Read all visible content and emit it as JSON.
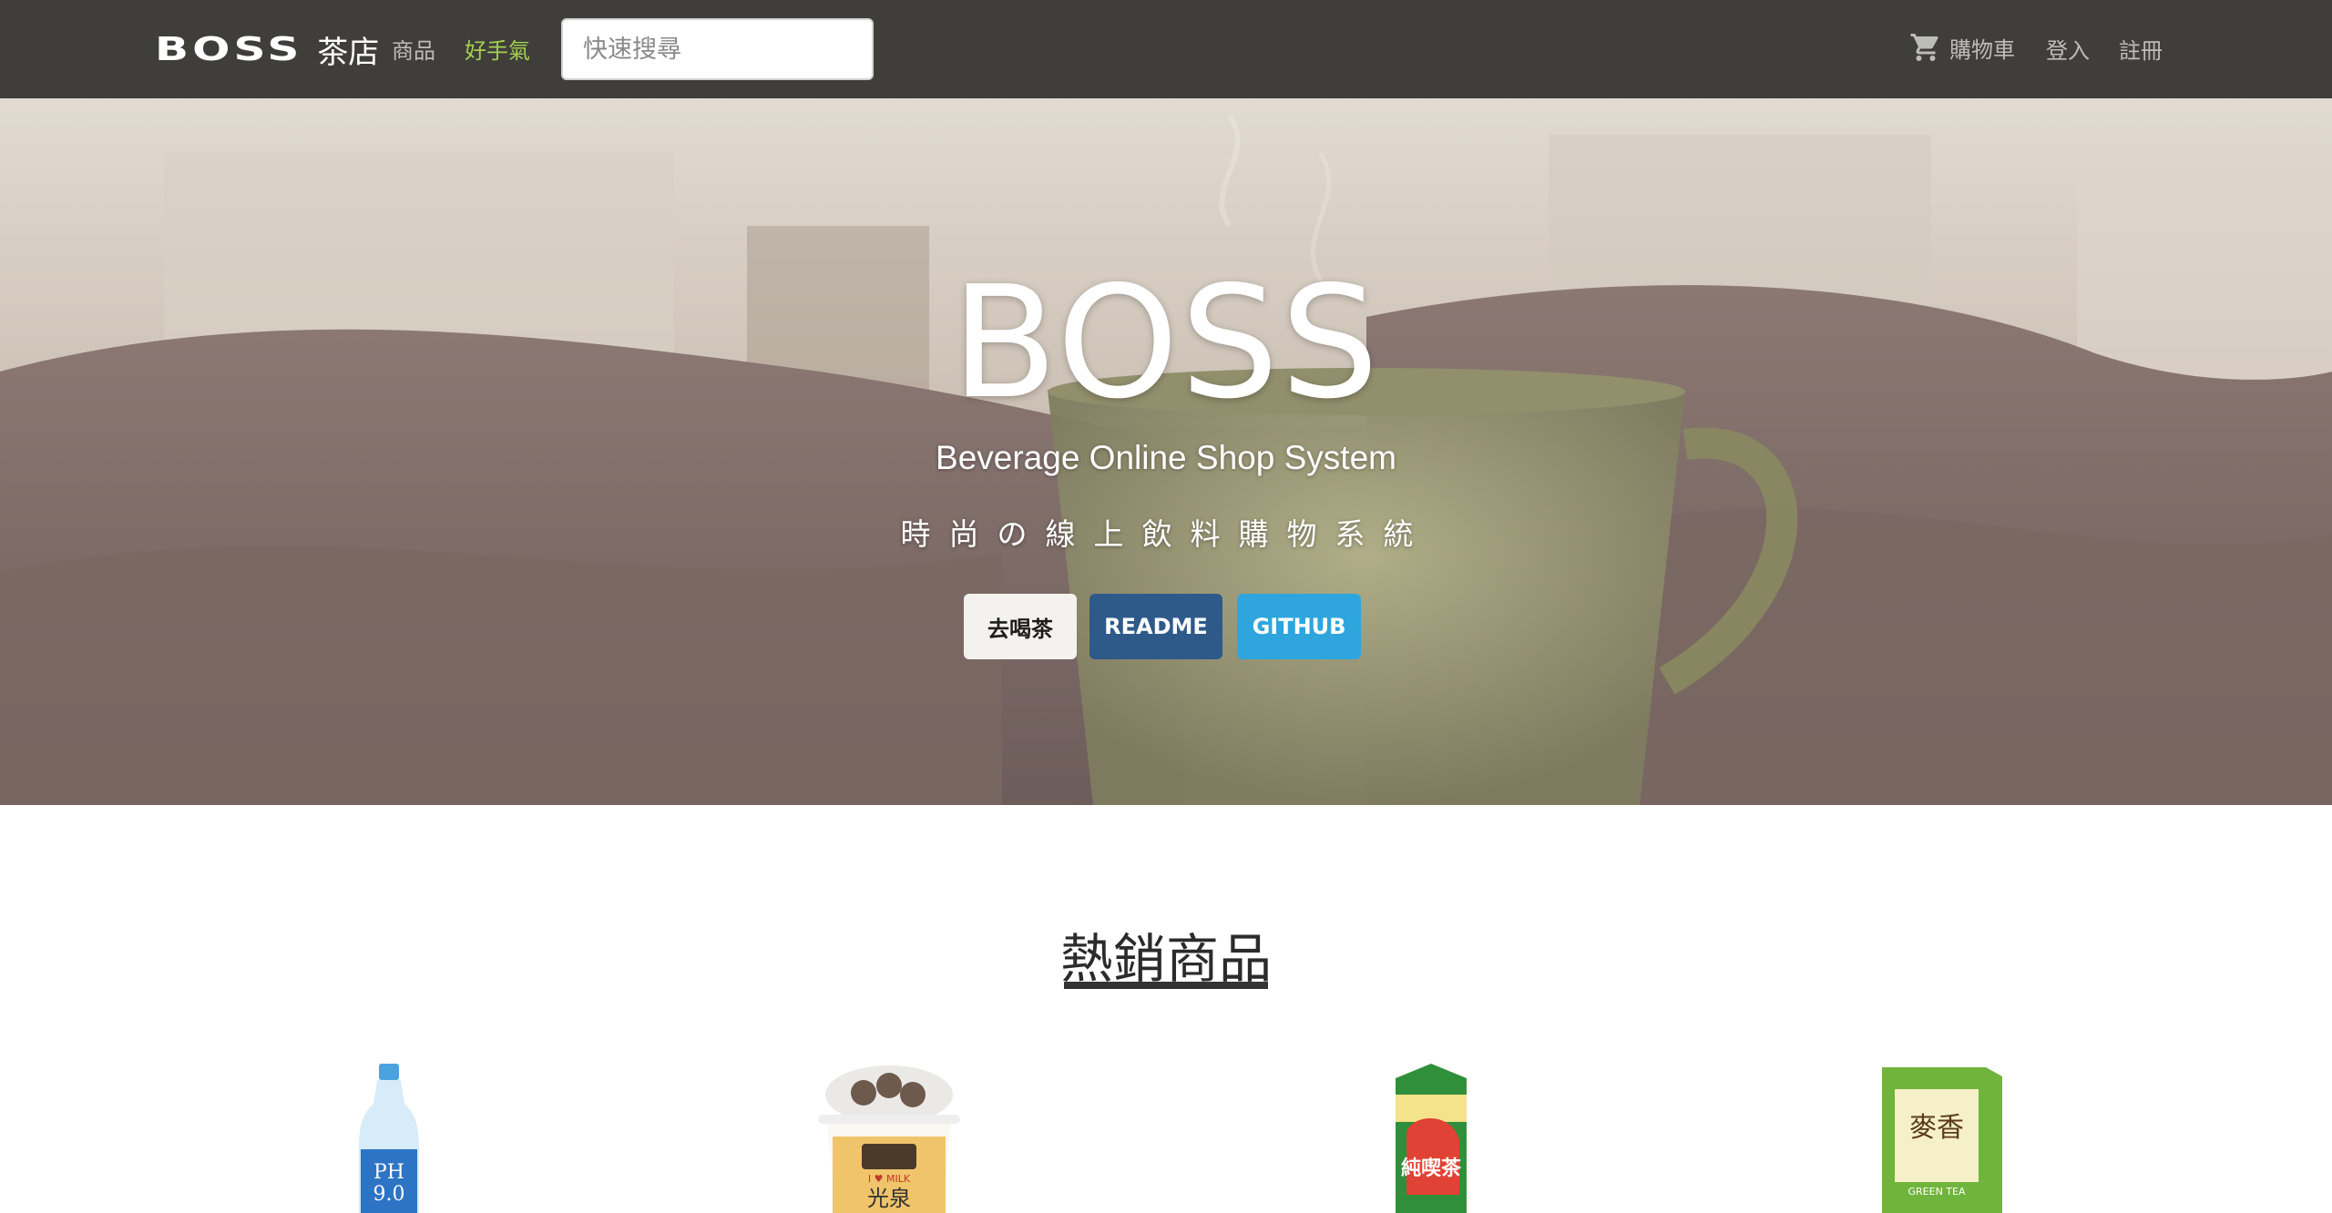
{
  "navbar": {
    "brand_logo": "BOSS",
    "brand_cn": "茶店",
    "links": [
      "商品",
      "好手氣"
    ],
    "search_placeholder": "快速搜尋",
    "cart_label": "購物車",
    "login_label": "登入",
    "register_label": "註冊"
  },
  "hero": {
    "title": "BOSS",
    "subtitle": "Beverage Online Shop System",
    "tagline": "時尚の線上飲料購物系統",
    "buttons": [
      "去喝茶",
      "README",
      "GITHUB"
    ]
  },
  "section": {
    "title": "熱銷商品"
  },
  "products": [
    {
      "label": "PH",
      "sub": "9.0"
    },
    {
      "label": "I ♥ MILK",
      "sub": "光泉"
    },
    {
      "label": "純喫茶",
      "sub": ""
    },
    {
      "label": "麥香",
      "sub": "GREEN TEA"
    }
  ],
  "colors": {
    "navbar_bg": "#3f3e3a",
    "nav_active": "#a4d050",
    "readme_btn": "#2e5a8a",
    "github_btn": "#2ea5dd"
  }
}
